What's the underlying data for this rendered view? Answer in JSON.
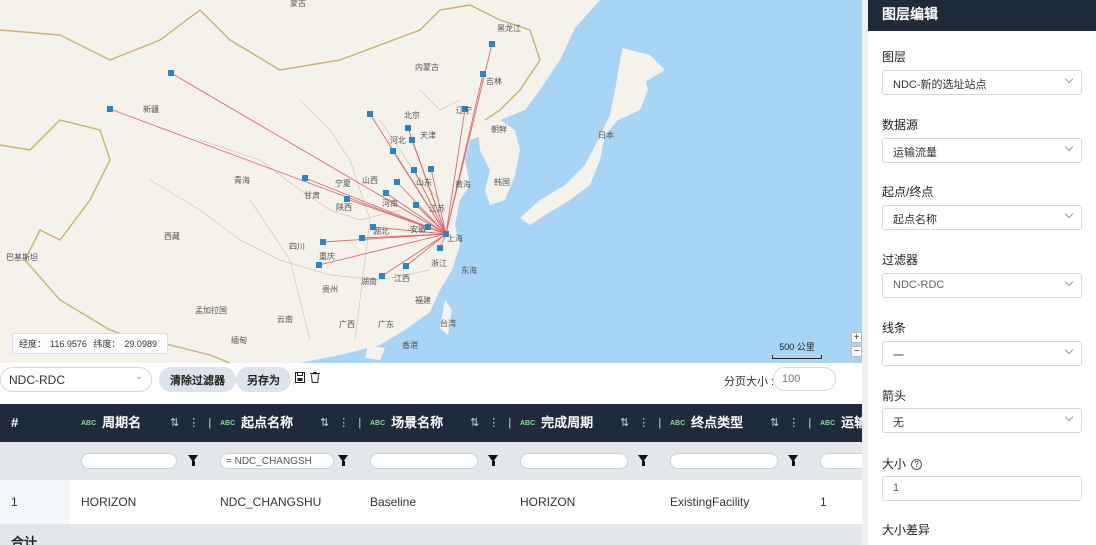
{
  "map": {
    "coordinates": {
      "lon_label": "经度：",
      "lon": "116.9576",
      "lat_label": "纬度：",
      "lat": "29.0989"
    },
    "scale": "500 公里",
    "zoom_in": "+",
    "zoom_out": "−",
    "place_labels": [
      "黑龙江",
      "吉林",
      "内蒙古",
      "辽宁",
      "北京",
      "天津",
      "河北",
      "山西",
      "山东",
      "河南",
      "陕西",
      "甘肃",
      "宁夏",
      "青海",
      "新疆",
      "西藏",
      "四川",
      "重庆",
      "湖北",
      "安徽",
      "江苏",
      "上海",
      "浙江",
      "江西",
      "湖南",
      "贵州",
      "云南",
      "广西",
      "广东",
      "福建",
      "台湾",
      "香港",
      "韩国",
      "朝鲜",
      "日本",
      "黄海",
      "东海",
      "巴基斯坦",
      "孟加拉国",
      "缅甸",
      "蒙古"
    ],
    "colors": {
      "sea": "#a8d4f5",
      "land": "#f5f2ea",
      "route": "#e05a5a",
      "node": "#1e88d6",
      "border": "#c9b46a"
    }
  },
  "toolbar": {
    "filter_value": "NDC-RDC",
    "clear_filter": "清除过滤器",
    "save_as": "另存为",
    "page_size_label": "分页大小 :",
    "page_size_placeholder": "100"
  },
  "table": {
    "columns": [
      {
        "label": "#",
        "type": ""
      },
      {
        "label": "周期名",
        "type": "ABC"
      },
      {
        "label": "起点名称",
        "type": "ABC"
      },
      {
        "label": "场景名称",
        "type": "ABC"
      },
      {
        "label": "完成周期",
        "type": "ABC"
      },
      {
        "label": "终点类型",
        "type": "ABC"
      },
      {
        "label": "运输",
        "type": "ABC"
      }
    ],
    "filters": [
      "",
      "= NDC_CHANGSH",
      "",
      "",
      "",
      ""
    ],
    "rows": [
      [
        "1",
        "HORIZON",
        "NDC_CHANGSHU",
        "Baseline",
        "HORIZON",
        "ExistingFacility",
        "1"
      ]
    ],
    "total_label": "合计"
  },
  "panel": {
    "title": "图层编辑",
    "layer_label": "图层",
    "layer_value": "NDC-新的选址站点",
    "datasource_label": "数据源",
    "datasource_value": "运输流量",
    "endpoint_label": "起点/终点",
    "endpoint_value": "起点名称",
    "filter_label": "过滤器",
    "filter_value": "NDC-RDC",
    "line_label": "线条",
    "line_value": "一",
    "arrow_label": "箭头",
    "arrow_value": "无",
    "size_label": "大小",
    "size_value": "1",
    "size_diff_label": "大小差异"
  }
}
